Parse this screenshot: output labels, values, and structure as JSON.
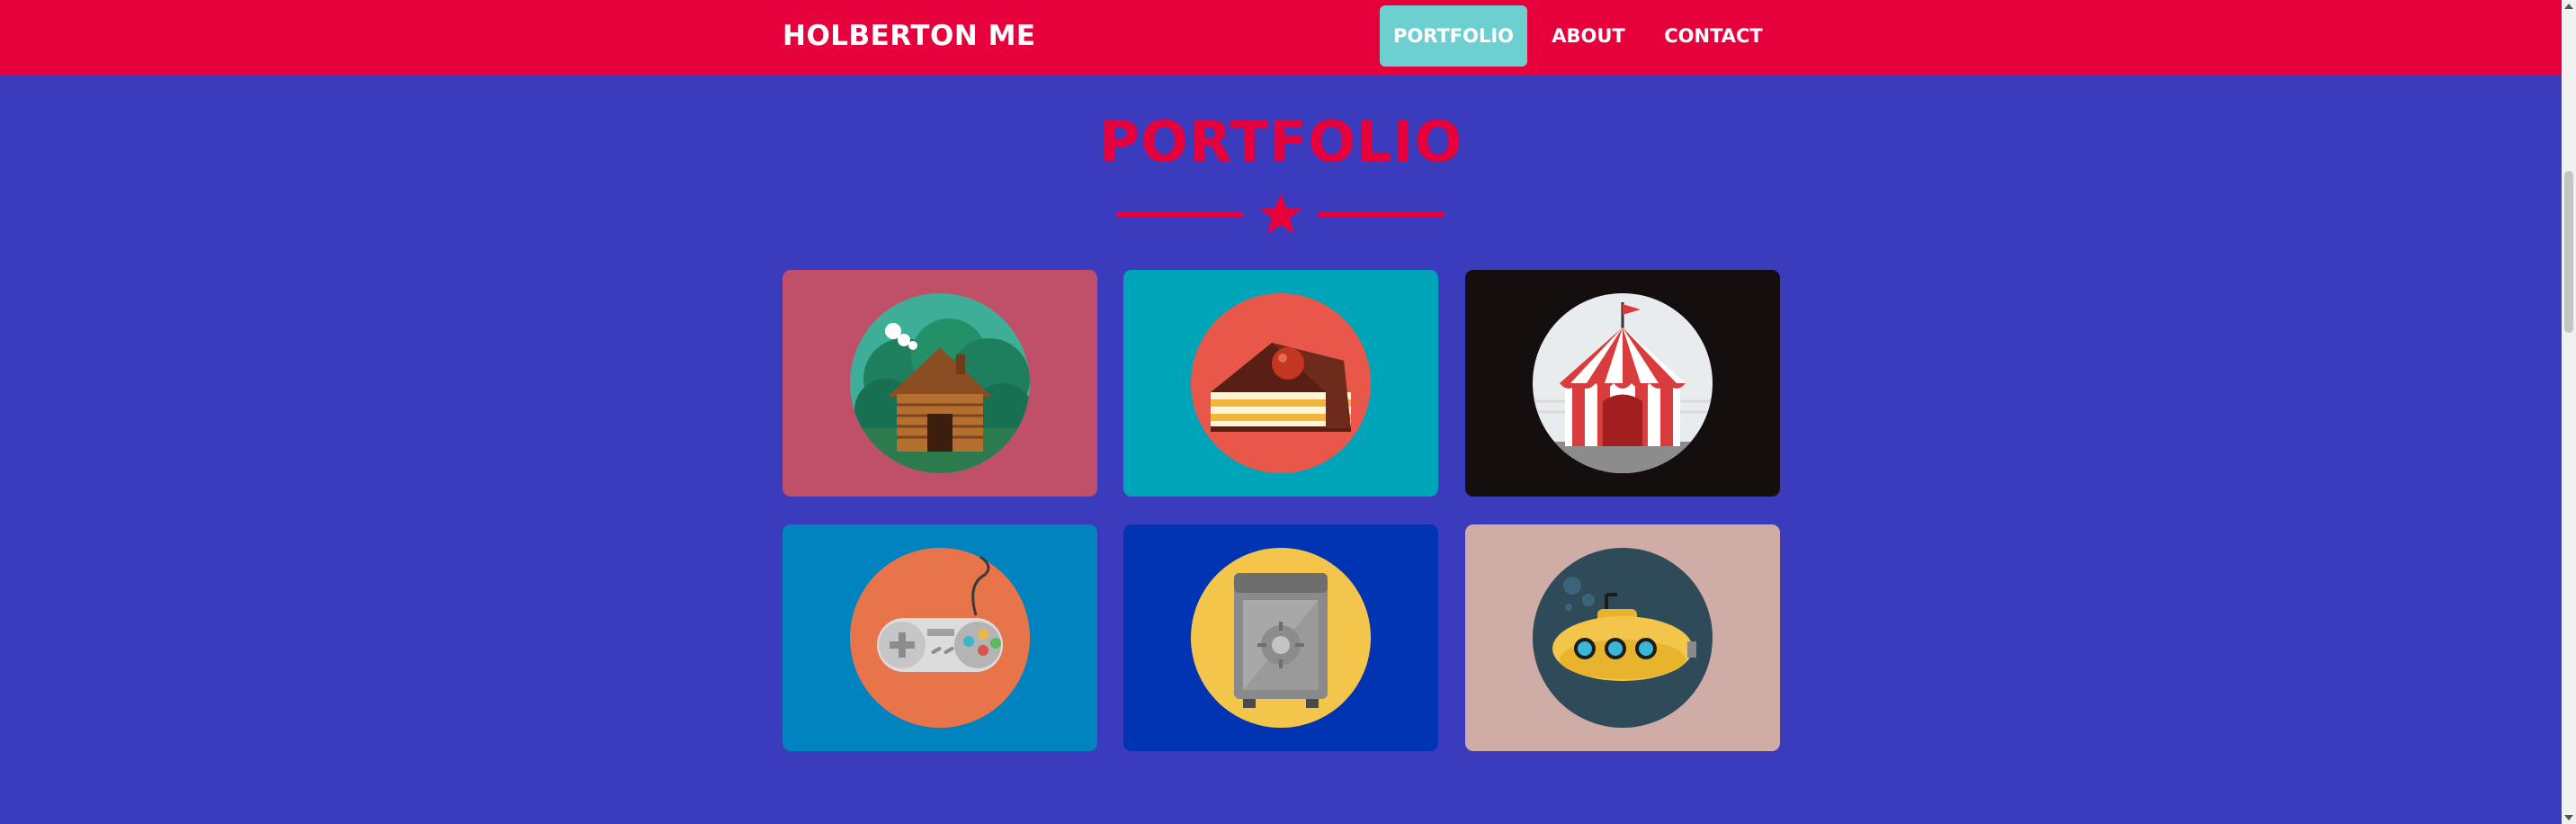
{
  "header": {
    "brand": "HOLBERTON ME",
    "nav": [
      {
        "label": "PORTFOLIO",
        "active": true
      },
      {
        "label": "ABOUT",
        "active": false
      },
      {
        "label": "CONTACT",
        "active": false
      }
    ]
  },
  "portfolio": {
    "title": "PORTFOLIO",
    "items": [
      {
        "icon": "cabin-icon",
        "bg": "#c0506a"
      },
      {
        "icon": "cake-icon",
        "bg": "#00a4b8"
      },
      {
        "icon": "circus-tent-icon",
        "bg": "#150e0e"
      },
      {
        "icon": "game-controller-icon",
        "bg": "#0083bf"
      },
      {
        "icon": "safe-icon",
        "bg": "#0034b2"
      },
      {
        "icon": "submarine-icon",
        "bg": "#cfada6"
      }
    ]
  },
  "colors": {
    "page_bg": "#3b3bbe",
    "accent": "#e6003c",
    "active_nav": "#6ecfd0"
  }
}
